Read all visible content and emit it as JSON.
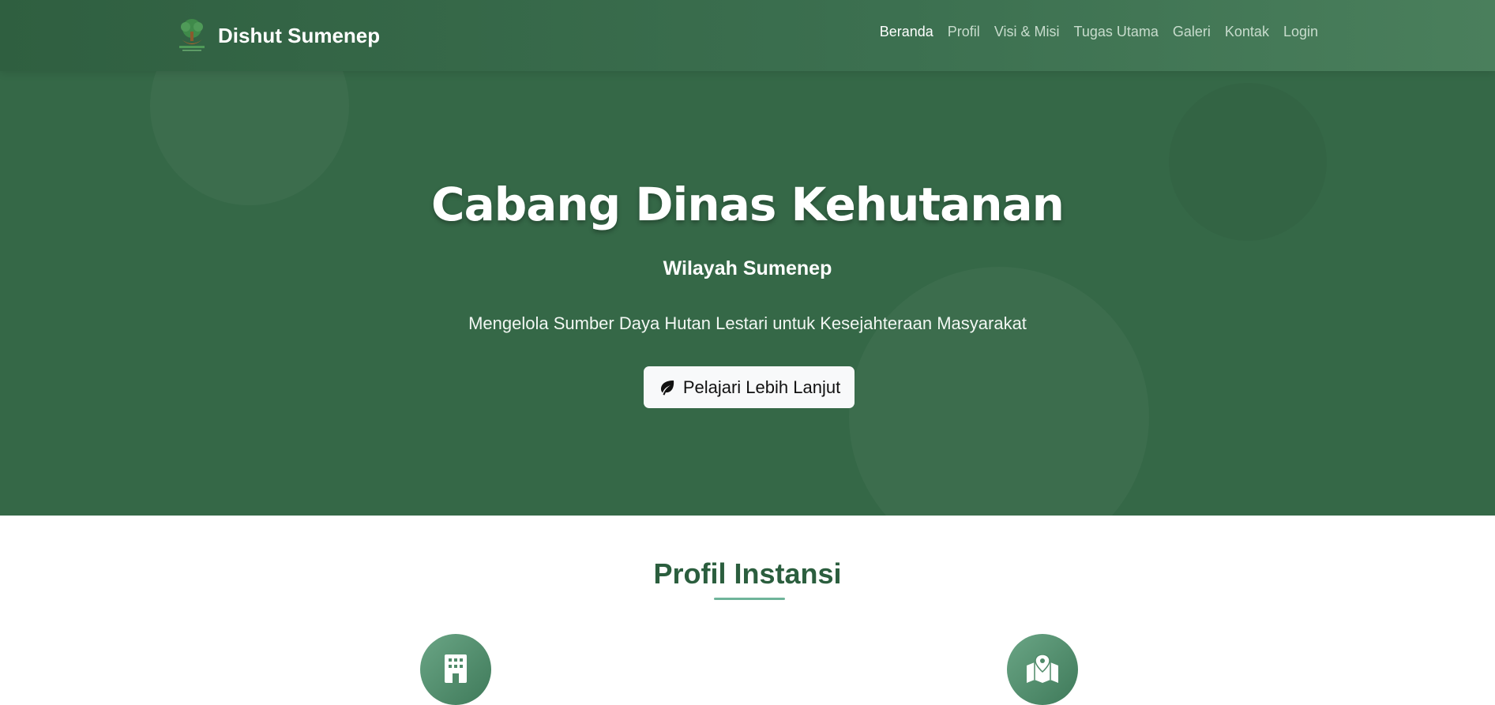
{
  "brand": {
    "name": "Dishut Sumenep",
    "logo_icon": "tree-logo-icon"
  },
  "nav": {
    "items": [
      {
        "label": "Beranda",
        "active": true
      },
      {
        "label": "Profil",
        "active": false
      },
      {
        "label": "Visi & Misi",
        "active": false
      },
      {
        "label": "Tugas Utama",
        "active": false
      },
      {
        "label": "Galeri",
        "active": false
      },
      {
        "label": "Kontak",
        "active": false
      },
      {
        "label": "Login",
        "active": false
      }
    ]
  },
  "hero": {
    "title": "Cabang Dinas Kehutanan",
    "subtitle": "Wilayah Sumenep",
    "tagline": "Mengelola Sumber Daya Hutan Lestari untuk Kesejahteraan Masyarakat",
    "cta_label": "Pelajari Lebih Lanjut",
    "cta_icon": "leaf-icon"
  },
  "profile_section": {
    "title": "Profil Instansi",
    "feature_icons": [
      "building-icon",
      "map-location-icon"
    ]
  },
  "colors": {
    "hero_background": "#356847",
    "navbar_start": "#2f5f40",
    "navbar_end": "#4a7f5c",
    "section_title": "#2b5e3e",
    "accent_underline": "#6fb49a",
    "nav_inactive": "#c8dccd",
    "nav_active": "#ffffff"
  }
}
